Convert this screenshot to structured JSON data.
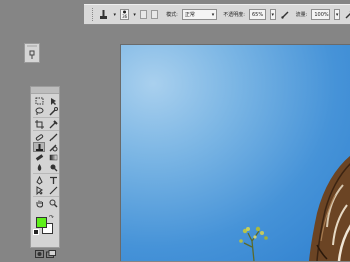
{
  "options_bar": {
    "brush_size": "36",
    "mode_label": "模式:",
    "mode_value": "正常",
    "opacity_label": "不透明度:",
    "opacity_value": "65%",
    "flow_label": "流量:",
    "flow_value": "100%"
  },
  "tools": [
    "marquee-tool",
    "move-tool",
    "lasso-tool",
    "quick-select-tool",
    "crop-tool",
    "eyedropper-tool",
    "healing-brush-tool",
    "brush-tool",
    "clone-stamp-tool",
    "history-brush-tool",
    "eraser-tool",
    "gradient-tool",
    "blur-tool",
    "dodge-tool",
    "pen-tool",
    "type-tool",
    "path-select-tool",
    "shape-tool",
    "hand-tool",
    "zoom-tool"
  ],
  "colors": {
    "foreground": "#5ef01a",
    "background": "#ffffff",
    "sky": "#4a96da"
  }
}
